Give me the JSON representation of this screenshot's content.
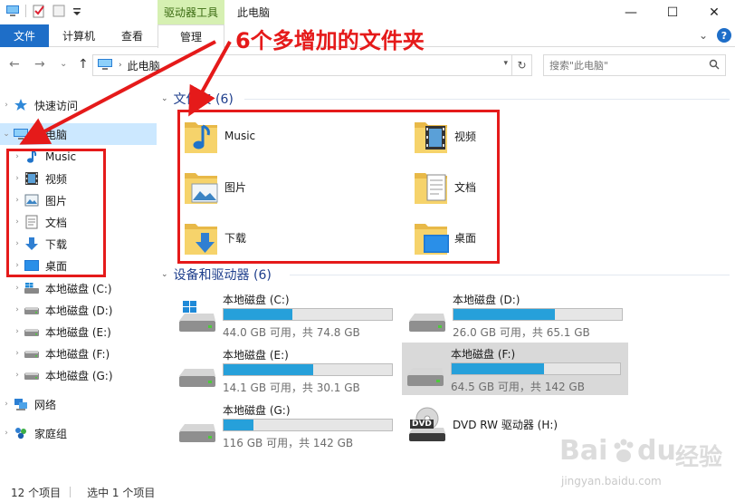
{
  "title_bar": {
    "context_tab": "驱动器工具",
    "window_title": "此电脑",
    "minimize": "—",
    "maximize": "☐",
    "close": "✕"
  },
  "ribbon": {
    "tabs": [
      "文件",
      "计算机",
      "查看",
      "管理"
    ],
    "collapse": "⌄",
    "help": "?"
  },
  "address_bar": {
    "back": "←",
    "forward": "→",
    "recent": "⌄",
    "up": "↑",
    "location": "此电脑",
    "refresh": "↻",
    "dropdown": "▾",
    "search_placeholder": "搜索\"此电脑\""
  },
  "nav_pane": {
    "quick_access": "快速访问",
    "this_pc": "此电脑",
    "children": [
      "Music",
      "视频",
      "图片",
      "文档",
      "下载",
      "桌面"
    ],
    "drives": [
      "本地磁盘 (C:)",
      "本地磁盘 (D:)",
      "本地磁盘 (E:)",
      "本地磁盘 (F:)",
      "本地磁盘 (G:)"
    ],
    "network": "网络",
    "homegroup": "家庭组"
  },
  "content": {
    "folders_header": "文件夹 (6)",
    "folders": [
      "Music",
      "视频",
      "图片",
      "文档",
      "下载",
      "桌面"
    ],
    "devices_header": "设备和驱动器 (6)",
    "drives": [
      {
        "name": "本地磁盘 (C:)",
        "free": "44.0 GB 可用，共 74.8 GB",
        "used_fraction": 0.41
      },
      {
        "name": "本地磁盘 (D:)",
        "free": "26.0 GB 可用，共 65.1 GB",
        "used_fraction": 0.6
      },
      {
        "name": "本地磁盘 (E:)",
        "free": "14.1 GB 可用，共 30.1 GB",
        "used_fraction": 0.53
      },
      {
        "name": "本地磁盘 (F:)",
        "free": "64.5 GB 可用，共 142 GB",
        "used_fraction": 0.55
      },
      {
        "name": "本地磁盘 (G:)",
        "free": "116 GB 可用，共 142 GB",
        "used_fraction": 0.18
      }
    ],
    "dvd_drive": "DVD RW 驱动器 (H:)",
    "dvd_label": "DVD"
  },
  "status_bar": {
    "items": "12 个项目",
    "selected": "选中 1 个项目"
  },
  "annotation": {
    "text": "6个多增加的文件夹"
  },
  "watermark": {
    "text": "jingyan.baidu.com",
    "brand_left": "Bai",
    "brand_mid": "du",
    "brand_right": "经验"
  },
  "colors": {
    "accent": "#1e6ec8",
    "context_tab": "#d6f0b2",
    "selection": "#cce8ff",
    "drive_fill": "#26a0da",
    "annotation": "#e51a1a"
  }
}
